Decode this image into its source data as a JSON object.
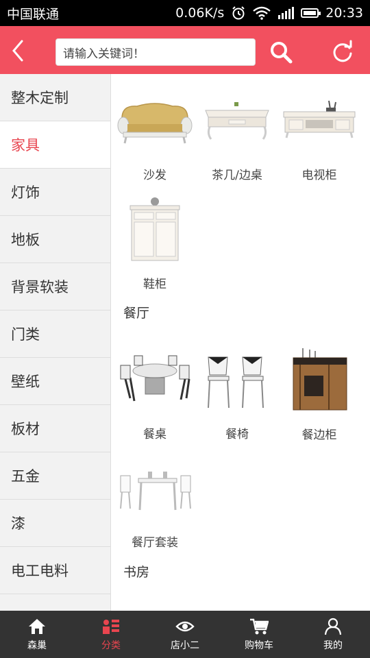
{
  "status_bar": {
    "carrier": "中国联通",
    "speed": "0.06K/s",
    "time": "20:33"
  },
  "header": {
    "search_placeholder": "请输入关键词！"
  },
  "sidebar": {
    "items": [
      {
        "label": "整木定制",
        "active": false
      },
      {
        "label": "家具",
        "active": true
      },
      {
        "label": "灯饰",
        "active": false
      },
      {
        "label": "地板",
        "active": false
      },
      {
        "label": "背景软装",
        "active": false
      },
      {
        "label": "门类",
        "active": false
      },
      {
        "label": "壁纸",
        "active": false
      },
      {
        "label": "板材",
        "active": false
      },
      {
        "label": "五金",
        "active": false
      },
      {
        "label": "漆",
        "active": false
      },
      {
        "label": "电工电料",
        "active": false
      }
    ]
  },
  "content": {
    "group1": {
      "items": [
        {
          "label": "沙发",
          "icon": "sofa-image"
        },
        {
          "label": "茶几/边桌",
          "icon": "coffee-table-image"
        },
        {
          "label": "电视柜",
          "icon": "tv-cabinet-image"
        },
        {
          "label": "鞋柜",
          "icon": "shoe-cabinet-image"
        }
      ]
    },
    "group2": {
      "title": "餐厅",
      "items": [
        {
          "label": "餐桌",
          "icon": "dining-table-image"
        },
        {
          "label": "餐椅",
          "icon": "dining-chair-image"
        },
        {
          "label": "餐边柜",
          "icon": "sideboard-image"
        },
        {
          "label": "餐厅套装",
          "icon": "dining-set-image"
        }
      ]
    },
    "group3": {
      "title": "书房"
    }
  },
  "bottom_nav": {
    "items": [
      {
        "label": "森巢",
        "active": false
      },
      {
        "label": "分类",
        "active": true
      },
      {
        "label": "店小二",
        "active": false
      },
      {
        "label": "购物车",
        "active": false
      },
      {
        "label": "我的",
        "active": false
      }
    ]
  },
  "colors": {
    "accent": "#f2505f",
    "active_text": "#e8454f",
    "nav_bg": "#333333"
  }
}
